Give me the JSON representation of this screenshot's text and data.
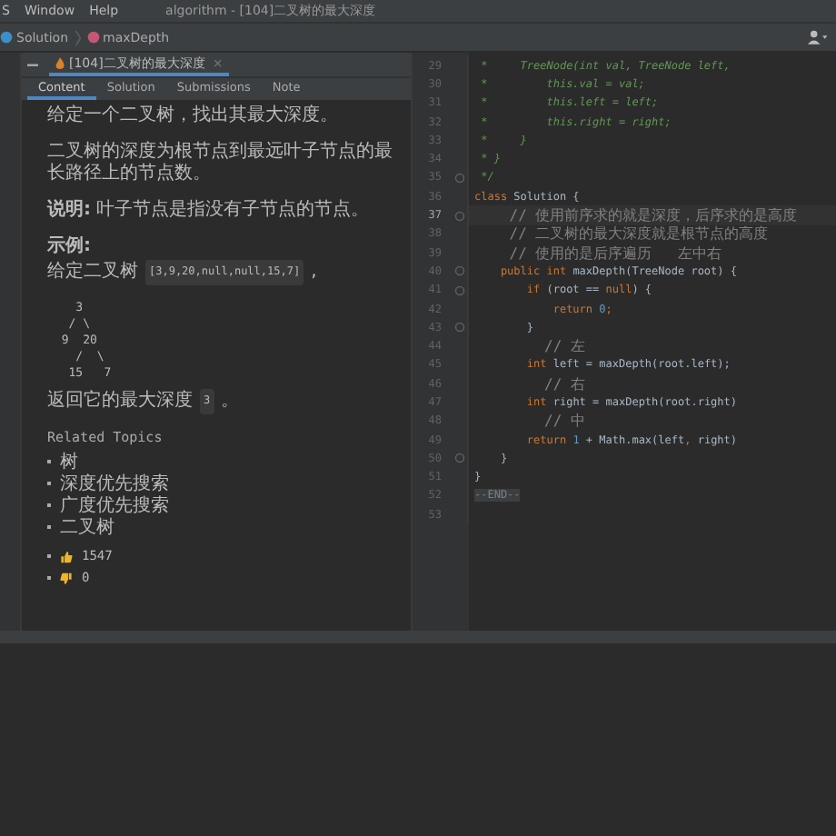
{
  "menu": [
    "S",
    "Window",
    "Help"
  ],
  "window_title": "algorithm - [104]二叉树的最大深度",
  "breadcrumb": [
    "Solution",
    "maxDepth"
  ],
  "file_tab": {
    "title": "[104]二叉树的最大深度",
    "close": "×"
  },
  "tabs": [
    {
      "label": "Content",
      "selected": true
    },
    {
      "label": "Solution",
      "selected": false
    },
    {
      "label": "Submissions",
      "selected": false
    },
    {
      "label": "Note",
      "selected": false
    }
  ],
  "content": [
    {
      "kind": "text",
      "text": "给定一个二叉树，找出其最大深度。"
    },
    {
      "kind": "text",
      "text": "二叉树的深度为根节点到最远叶子节点的最长路径上的节点数。"
    },
    {
      "kind": "text",
      "text": "**说明:** 叶子节点是指没有子节点的节点。"
    },
    {
      "kind": "heading",
      "text": "示例:"
    },
    {
      "kind": "example",
      "text": "给定二叉树",
      "code": "[3,9,20,null,null,15,7]",
      "after": ","
    },
    {
      "kind": "tree",
      "lines": [
        "    3",
        "   / \\",
        "  9  20",
        "    /  \\",
        "   15   7"
      ]
    },
    {
      "kind": "example",
      "text": "返回它的最大深度",
      "code": "3",
      "after": "。"
    }
  ],
  "topics": {
    "title": "Related Topics",
    "items": [
      "树",
      "深度优先搜索",
      "广度优先搜索",
      "二叉树"
    ]
  },
  "votes": [
    {
      "kind": "up",
      "count": "1547"
    },
    {
      "kind": "down",
      "count": "0"
    }
  ],
  "code": [
    {
      "number": "29",
      "selected": false,
      "fold": false,
      "tokens": [
        {
          "kind": "doc",
          "t": " *     TreeNode(int val, TreeNode left,"
        }
      ]
    },
    {
      "number": "30",
      "selected": false,
      "fold": false,
      "tokens": [
        {
          "kind": "doc",
          "t": " *         this.val = val;"
        }
      ]
    },
    {
      "number": "31",
      "selected": false,
      "fold": false,
      "tokens": [
        {
          "kind": "doc",
          "t": " *         this.left = left;"
        }
      ]
    },
    {
      "number": "32",
      "selected": false,
      "fold": false,
      "tokens": [
        {
          "kind": "doc",
          "t": " *         this.right = right;"
        }
      ]
    },
    {
      "number": "33",
      "selected": false,
      "fold": false,
      "tokens": [
        {
          "kind": "doc",
          "t": " *     }"
        }
      ]
    },
    {
      "number": "34",
      "selected": false,
      "fold": false,
      "tokens": [
        {
          "kind": "doc",
          "t": " * }"
        }
      ]
    },
    {
      "number": "35",
      "selected": false,
      "fold": true,
      "tokens": [
        {
          "kind": "doc",
          "t": " */"
        }
      ]
    },
    {
      "number": "36",
      "selected": false,
      "fold": false,
      "tokens": [
        {
          "kind": "kw",
          "t": "class"
        },
        {
          "kind": "plain",
          "t": " Solution {"
        }
      ]
    },
    {
      "number": "37",
      "selected": true,
      "fold": true,
      "tokens": [
        {
          "kind": "cm",
          "t": "    // 使用前序求的就是深度，后序求的是高度"
        }
      ]
    },
    {
      "number": "38",
      "selected": false,
      "fold": false,
      "tokens": [
        {
          "kind": "cm",
          "t": "    // 二叉树的最大深度就是根节点的高度"
        }
      ]
    },
    {
      "number": "39",
      "selected": false,
      "fold": false,
      "tokens": [
        {
          "kind": "cm",
          "t": "    // 使用的是后序遍历   左中右"
        }
      ]
    },
    {
      "number": "40",
      "selected": false,
      "fold": true,
      "tokens": [
        {
          "kind": "kw",
          "t": "    public int"
        },
        {
          "kind": "plain",
          "t": " maxDepth(TreeNode root) {"
        }
      ]
    },
    {
      "number": "41",
      "selected": false,
      "fold": true,
      "tokens": [
        {
          "kind": "kw",
          "t": "        if"
        },
        {
          "kind": "plain",
          "t": " (root == "
        },
        {
          "kind": "kw",
          "t": "null"
        },
        {
          "kind": "plain",
          "t": ") {"
        }
      ]
    },
    {
      "number": "42",
      "selected": false,
      "fold": false,
      "tokens": [
        {
          "kind": "kw",
          "t": "            return"
        },
        {
          "kind": "num",
          "t": " 0"
        },
        {
          "kind": "kw",
          "t": ";"
        }
      ]
    },
    {
      "number": "43",
      "selected": false,
      "fold": true,
      "tokens": [
        {
          "kind": "plain",
          "t": "        }"
        }
      ]
    },
    {
      "number": "44",
      "selected": false,
      "fold": false,
      "tokens": [
        {
          "kind": "cm",
          "t": "        // 左"
        }
      ]
    },
    {
      "number": "45",
      "selected": false,
      "fold": false,
      "tokens": [
        {
          "kind": "kw",
          "t": "        int"
        },
        {
          "kind": "plain",
          "t": " left = maxDepth(root.left);"
        }
      ]
    },
    {
      "number": "46",
      "selected": false,
      "fold": false,
      "tokens": [
        {
          "kind": "cm",
          "t": "        // 右"
        }
      ]
    },
    {
      "number": "47",
      "selected": false,
      "fold": false,
      "tokens": [
        {
          "kind": "kw",
          "t": "        int"
        },
        {
          "kind": "plain",
          "t": " right = maxDepth(root.right)"
        }
      ]
    },
    {
      "number": "48",
      "selected": false,
      "fold": false,
      "tokens": [
        {
          "kind": "cm",
          "t": "        // 中"
        }
      ]
    },
    {
      "number": "49",
      "selected": false,
      "fold": false,
      "tokens": [
        {
          "kind": "kw",
          "t": "        return"
        },
        {
          "kind": "num",
          "t": " 1"
        },
        {
          "kind": "plain",
          "t": " + Math.max(left"
        },
        {
          "kind": "kw",
          "t": ","
        },
        {
          "kind": "plain",
          "t": " right)"
        }
      ]
    },
    {
      "number": "50",
      "selected": false,
      "fold": true,
      "tokens": [
        {
          "kind": "plain",
          "t": "    }"
        }
      ]
    },
    {
      "number": "51",
      "selected": false,
      "fold": false,
      "tokens": [
        {
          "kind": "plain",
          "t": "}"
        }
      ]
    },
    {
      "number": "52",
      "selected": false,
      "fold": false,
      "tokens": [
        {
          "kind": "end",
          "t": "--END--"
        }
      ]
    },
    {
      "number": "53",
      "selected": false,
      "fold": false
    }
  ]
}
